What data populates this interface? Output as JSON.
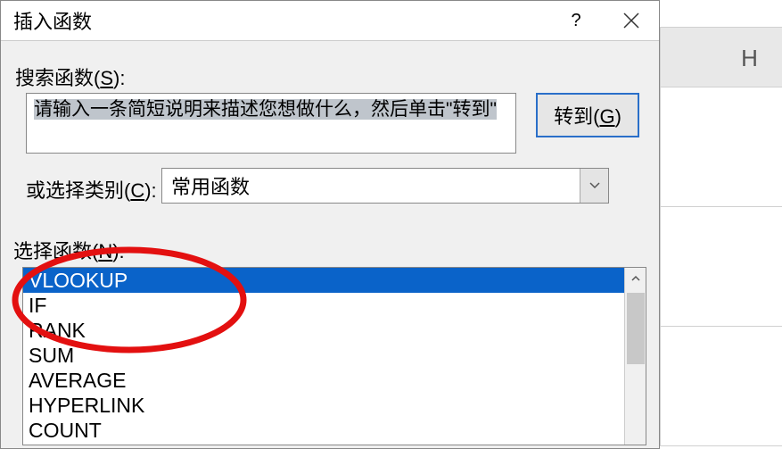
{
  "sheet": {
    "column_header": "H"
  },
  "dialog": {
    "title": "插入函数",
    "help_label": "?",
    "search_label_pre": "搜索函数(",
    "search_label_key": "S",
    "search_label_post": "):",
    "search_text": "请输入一条简短说明来描述您想做什么，然后单击\"转到\"",
    "go_button_pre": "转到(",
    "go_button_key": "G",
    "go_button_post": ")",
    "category_label_pre": "或选择类别(",
    "category_label_key": "C",
    "category_label_post": ": ",
    "category_value": "常用函数",
    "function_label_pre": "选择函数(",
    "function_label_key": "N",
    "function_label_post": "):",
    "functions": {
      "f0": "VLOOKUP",
      "f1": "IF",
      "f2": "RANK",
      "f3": "SUM",
      "f4": "AVERAGE",
      "f5": "HYPERLINK",
      "f6": "COUNT"
    },
    "selected_function_index": 0
  }
}
